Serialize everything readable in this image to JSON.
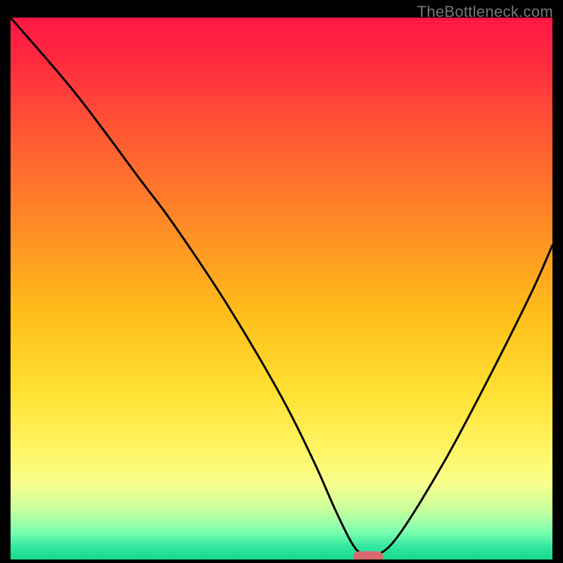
{
  "watermark": "TheBottleneck.com",
  "chart_data": {
    "type": "line",
    "title": "",
    "xlabel": "",
    "ylabel": "",
    "xlim": [
      0,
      100
    ],
    "ylim": [
      0,
      100
    ],
    "grid": false,
    "legend": null,
    "background_gradient": {
      "stops": [
        {
          "offset": 0,
          "color": "#ff1744"
        },
        {
          "offset": 0.08,
          "color": "#ff2a3f"
        },
        {
          "offset": 0.22,
          "color": "#ff5a33"
        },
        {
          "offset": 0.38,
          "color": "#ff8a26"
        },
        {
          "offset": 0.55,
          "color": "#ffbf1a"
        },
        {
          "offset": 0.7,
          "color": "#ffe236"
        },
        {
          "offset": 0.8,
          "color": "#fff566"
        },
        {
          "offset": 0.86,
          "color": "#f8ff8c"
        },
        {
          "offset": 0.91,
          "color": "#c6ff9e"
        },
        {
          "offset": 0.95,
          "color": "#7affb0"
        },
        {
          "offset": 0.975,
          "color": "#35e8a0"
        },
        {
          "offset": 1.0,
          "color": "#18d98f"
        }
      ]
    },
    "series": [
      {
        "name": "bottleneck-curve",
        "x": [
          0,
          12,
          24,
          30,
          40,
          50,
          56,
          60,
          63,
          65,
          68,
          72,
          80,
          88,
          96,
          100
        ],
        "y": [
          100,
          86,
          70,
          62,
          47,
          30,
          18,
          9,
          3,
          1,
          1,
          5,
          18,
          33,
          49,
          58
        ]
      }
    ],
    "marker": {
      "name": "optimal-point",
      "x": 66,
      "y": 0.5,
      "color": "#d86a6f",
      "width": 5.5,
      "height": 2
    }
  }
}
